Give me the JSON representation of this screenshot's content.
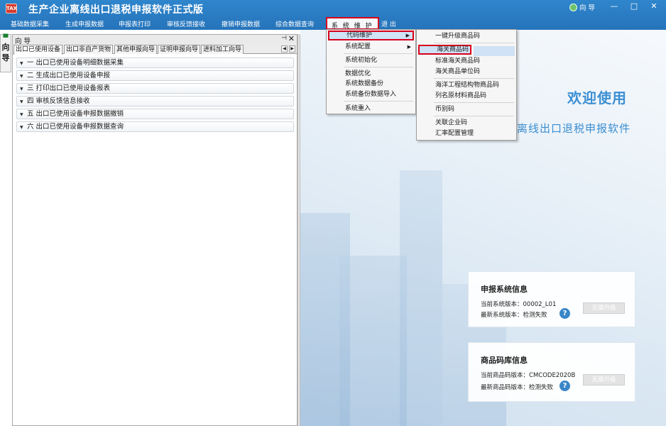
{
  "app": {
    "title": "生产企业离线出口退税申报软件正式版",
    "icon_text": "TAX",
    "wizard_label": "向 导",
    "min_symbol": "—",
    "restore_symbol": "□",
    "close_symbol": "✕"
  },
  "menubar": [
    {
      "label": "基础数据采集"
    },
    {
      "label": "生成申报数据"
    },
    {
      "label": "申报表打印"
    },
    {
      "label": "审核反馈接收"
    },
    {
      "label": "撤销申报数据"
    },
    {
      "label": "综合数据查询"
    },
    {
      "label": "系 统 维 护"
    },
    {
      "label": "退 出"
    }
  ],
  "side_tab": {
    "label_1": "向",
    "label_2": "导",
    "icon": "pin-icon"
  },
  "left_panel": {
    "title": "向 导",
    "pin_symbol": "⊣",
    "close_symbol": "✕",
    "tabs": [
      "出口已使用设备",
      "出口非自产货物",
      "其他申报向导",
      "证明申报向导",
      "进料加工向导"
    ],
    "tab_scroll_left": "◀",
    "tab_scroll_right": "▶",
    "items": [
      "一 出口已使用设备明细数据采集",
      "二 生成出口已使用设备申报",
      "三 打印出口已使用设备报表",
      "四 审核反馈信息接收",
      "五 出口已使用设备申报数据撤销",
      "六 出口已使用设备申报数据查询"
    ],
    "item_arrow": "▼"
  },
  "menus": {
    "system_menu": [
      {
        "label": "代码维护",
        "submenu": true
      },
      {
        "label": "系统配置",
        "submenu": true
      },
      {
        "label": "系统初始化"
      },
      {
        "label": "数据优化"
      },
      {
        "label": "系统数据备份"
      },
      {
        "label": "系统备份数据导入"
      },
      {
        "label": "系统重入"
      }
    ],
    "submenu_arrow": "▶",
    "code_menu": [
      {
        "label": "一键升级商品码"
      },
      {
        "label": "海关商品码"
      },
      {
        "label": "标准海关商品码"
      },
      {
        "label": "海关商品单位码"
      },
      {
        "label": "海洋工程结构物商品码"
      },
      {
        "label": "列名原材料商品码"
      },
      {
        "label": "币别码"
      },
      {
        "label": "关联企业码"
      },
      {
        "label": "汇率配置管理"
      }
    ]
  },
  "content": {
    "welcome": "欢迎使用",
    "subtitle": "离线出口退税申报软件",
    "system_info": {
      "title": "申报系统信息",
      "current_label": "当前系统版本：",
      "current_value": "00002_L01",
      "latest_label": "最新系统版本：",
      "latest_value": "检测失败",
      "button": "无需升级"
    },
    "code_info": {
      "title": "商品码库信息",
      "current_label": "当前商品码版本：",
      "current_value": "CMCODE2020B",
      "latest_label": "最新商品码版本：",
      "latest_value": "检测失败",
      "button": "无需升级"
    },
    "help_symbol": "?"
  },
  "colors": {
    "titlebar": "#2a7bc2",
    "highlight_border": "#d8001c",
    "welcome_text": "#3c8fd3",
    "menu_highlight": "#cfe2f6"
  }
}
